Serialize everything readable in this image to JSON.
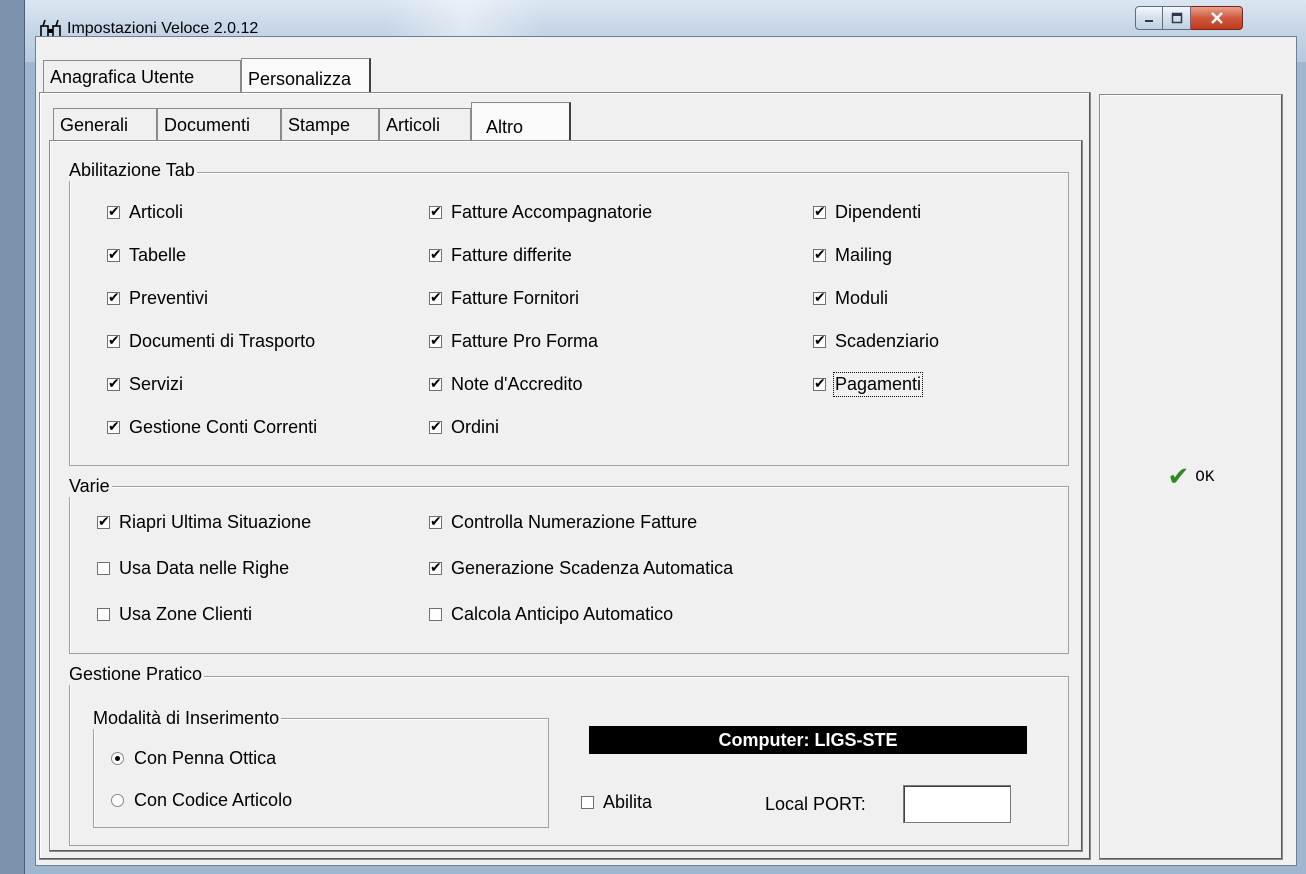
{
  "window": {
    "title": "Impostazioni Veloce 2.0.12",
    "icon": "binoculars-icon",
    "controls": {
      "minimize": "_",
      "maximize": "□",
      "close": "X"
    }
  },
  "outer_tabs": [
    "Anagrafica Utente",
    "Personalizza"
  ],
  "outer_active": "Personalizza",
  "inner_tabs": [
    "Generali",
    "Documenti",
    "Stampe",
    "Articoli",
    "Altro"
  ],
  "inner_active": "Altro",
  "abilitazione_tab": {
    "label": "Abilitazione Tab",
    "col1": [
      {
        "label": "Articoli",
        "checked": true
      },
      {
        "label": "Tabelle",
        "checked": true
      },
      {
        "label": "Preventivi",
        "checked": true
      },
      {
        "label": "Documenti di Trasporto",
        "checked": true
      },
      {
        "label": "Servizi",
        "checked": true
      },
      {
        "label": "Gestione Conti Correnti",
        "checked": true
      }
    ],
    "col2": [
      {
        "label": "Fatture Accompagnatorie",
        "checked": true
      },
      {
        "label": "Fatture differite",
        "checked": true
      },
      {
        "label": "Fatture Fornitori",
        "checked": true
      },
      {
        "label": "Fatture Pro Forma",
        "checked": true
      },
      {
        "label": "Note d'Accredito",
        "checked": true
      },
      {
        "label": "Ordini",
        "checked": true
      }
    ],
    "col3": [
      {
        "label": "Dipendenti",
        "checked": true
      },
      {
        "label": "Mailing",
        "checked": true
      },
      {
        "label": "Moduli",
        "checked": true
      },
      {
        "label": "Scadenziario",
        "checked": true
      },
      {
        "label": "Pagamenti",
        "checked": true
      }
    ]
  },
  "varie": {
    "label": "Varie",
    "col1": [
      {
        "label": "Riapri Ultima Situazione",
        "checked": true
      },
      {
        "label": "Usa Data nelle Righe",
        "checked": false
      },
      {
        "label": "Usa Zone Clienti",
        "checked": false
      }
    ],
    "col2": [
      {
        "label": "Controlla Numerazione Fatture",
        "checked": true
      },
      {
        "label": "Generazione  Scadenza Automatica",
        "checked": true
      },
      {
        "label": "Calcola Anticipo Automatico",
        "checked": false
      }
    ]
  },
  "gestione_pratico": {
    "label": "Gestione Pratico",
    "modalita": {
      "label": "Modalità di Inserimento",
      "options": [
        {
          "label": "Con Penna Ottica",
          "selected": true
        },
        {
          "label": "Con Codice Articolo",
          "selected": false
        }
      ]
    },
    "computer": "Computer: LIGS-STE",
    "abilita": {
      "label": "Abilita",
      "checked": false
    },
    "local_port": {
      "label": "Local PORT:",
      "value": ""
    }
  },
  "ok": {
    "label": "OK",
    "icon": "checkmark-icon"
  }
}
